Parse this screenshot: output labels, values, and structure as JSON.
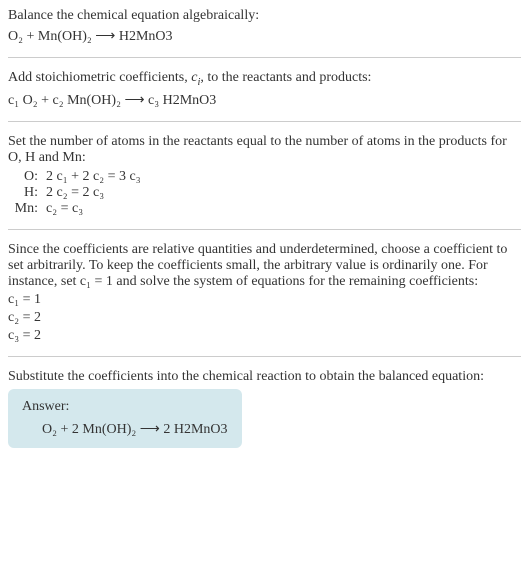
{
  "step1": {
    "text": "Balance the chemical equation algebraically:",
    "equation": "O₂ + Mn(OH)₂ ⟶ H2MnO3"
  },
  "step2": {
    "text_before": "Add stoichiometric coefficients, ",
    "c_i": "c",
    "text_after": ", to the reactants and products:",
    "equation": "c₁ O₂ + c₂ Mn(OH)₂ ⟶ c₃ H2MnO3"
  },
  "step3": {
    "text": "Set the number of atoms in the reactants equal to the number of atoms in the products for O, H and Mn:",
    "rows": [
      {
        "label": "O:",
        "eq": "2 c₁ + 2 c₂ = 3 c₃"
      },
      {
        "label": "H:",
        "eq": "2 c₂ = 2 c₃"
      },
      {
        "label": "Mn:",
        "eq": "c₂ = c₃"
      }
    ]
  },
  "step4": {
    "text": "Since the coefficients are relative quantities and underdetermined, choose a coefficient to set arbitrarily. To keep the coefficients small, the arbitrary value is ordinarily one. For instance, set c₁ = 1 and solve the system of equations for the remaining coefficients:",
    "coeffs": [
      "c₁ = 1",
      "c₂ = 2",
      "c₃ = 2"
    ]
  },
  "step5": {
    "text": "Substitute the coefficients into the chemical reaction to obtain the balanced equation:",
    "answer_label": "Answer:",
    "answer_eq": "O₂ + 2 Mn(OH)₂ ⟶ 2 H2MnO3"
  }
}
